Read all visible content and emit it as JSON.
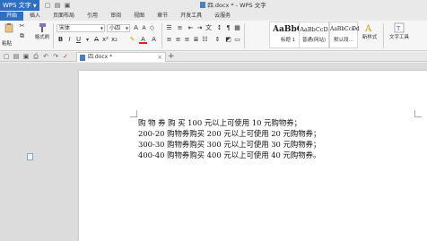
{
  "window": {
    "app_menu": "WPS 文字",
    "title": "四.docx * - WPS 文字"
  },
  "tabs": [
    {
      "label": "开始",
      "active": true
    },
    {
      "label": "插入"
    },
    {
      "label": "页面布局"
    },
    {
      "label": "引用"
    },
    {
      "label": "审阅"
    },
    {
      "label": "视图"
    },
    {
      "label": "章节"
    },
    {
      "label": "开发工具"
    },
    {
      "label": "云服务"
    }
  ],
  "ribbon": {
    "paste_label": "粘贴",
    "format_painter_label": "格式刷",
    "font_name": "宋体",
    "font_size": "小四",
    "style_heading": {
      "sample": "AaBbC",
      "label": "标题 1"
    },
    "style_body": {
      "sample": "AaBbCcD",
      "label": "普通(网站)"
    },
    "style_default": {
      "sample": "AaBbCcDd",
      "label": "默认段..."
    },
    "new_style_label": "新样式",
    "text_tools_label": "文字工具"
  },
  "document": {
    "tab_name": "四.docx *",
    "lines": [
      "购 物 券 购 买 100 元以上可使用 10 元购物券；",
      "200-20 购物券购买 200 元以上可使用 20 元购物券；",
      "300-30 购物券购买 300 元以上可使用 30 元购物券；",
      "400-40 购物券购买 400 元以上可使用 40 元购物券。"
    ]
  },
  "colors": {
    "accent": "#2e6fc1",
    "workspace": "#dcdcdc"
  }
}
